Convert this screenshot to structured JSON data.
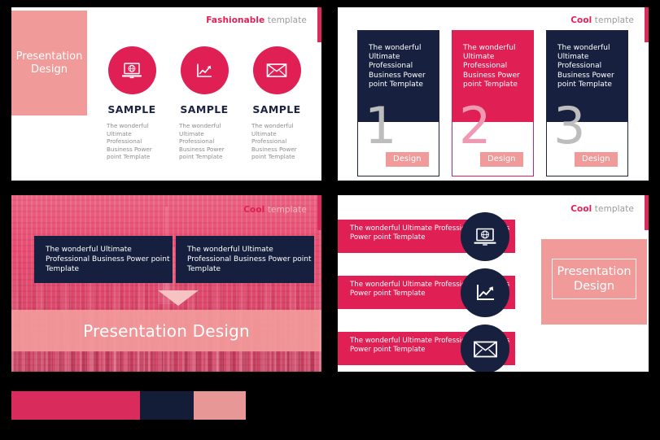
{
  "colors": {
    "crimson": "#e01f55",
    "navy": "#17213f",
    "salmon": "#f09a9a",
    "city_pink": "#e8456c",
    "grey_number": "#bdbdbd",
    "pink_number": "#ef9ab3",
    "body_grey": "#8c8c8c"
  },
  "slide1": {
    "name": "Fashionable template slide",
    "caption_strong": "Fashionable",
    "caption_light": "template",
    "pink_box_text": "Presentation Design",
    "columns": [
      {
        "icon": "laptop-globe-icon",
        "title": "SAMPLE",
        "desc": "The wonderful Ultimate Professional Business Power point Template"
      },
      {
        "icon": "growth-chart-icon",
        "title": "SAMPLE",
        "desc": "The wonderful Ultimate Professional Business Power point Template"
      },
      {
        "icon": "envelope-icon",
        "title": "SAMPLE",
        "desc": "The wonderful Ultimate Professional Business Power point Template"
      }
    ]
  },
  "slide2": {
    "name": "Cool template numbered cards slide",
    "caption_strong": "Cool",
    "caption_light": "template",
    "cards": [
      {
        "text": "The wonderful Ultimate Professional Business Power point Template",
        "number": "1",
        "button": "Design"
      },
      {
        "text": "The wonderful Ultimate Professional Business Power point Template",
        "number": "2",
        "button": "Design"
      },
      {
        "text": "The wonderful Ultimate Professional Business Power point Template",
        "number": "3",
        "button": "Design"
      }
    ]
  },
  "slide3": {
    "name": "Cool template city background slide",
    "caption_strong": "Cool",
    "caption_light": "template",
    "boxes": [
      "The wonderful Ultimate Professional Business Power point Template",
      "The wonderful Ultimate Professional Business Power point Template"
    ],
    "band_text": "Presentation Design"
  },
  "slide4": {
    "name": "Cool template icon list slide",
    "caption_strong": "Cool",
    "caption_light": "template",
    "rows": [
      {
        "text": "The wonderful Ultimate Professional Business Power point Template",
        "icon": "laptop-globe-icon"
      },
      {
        "text": "The wonderful Ultimate Professional Business Power point Template",
        "icon": "growth-chart-icon"
      },
      {
        "text": "The wonderful Ultimate Professional Business Power point Template",
        "icon": "envelope-icon"
      }
    ],
    "presentation_text": "Presentation Design"
  },
  "swatches": [
    {
      "label": "crimson",
      "hex": "#d92b5c"
    },
    {
      "label": "navy",
      "hex": "#141d38"
    },
    {
      "label": "salmon",
      "hex": "#e89797"
    }
  ]
}
